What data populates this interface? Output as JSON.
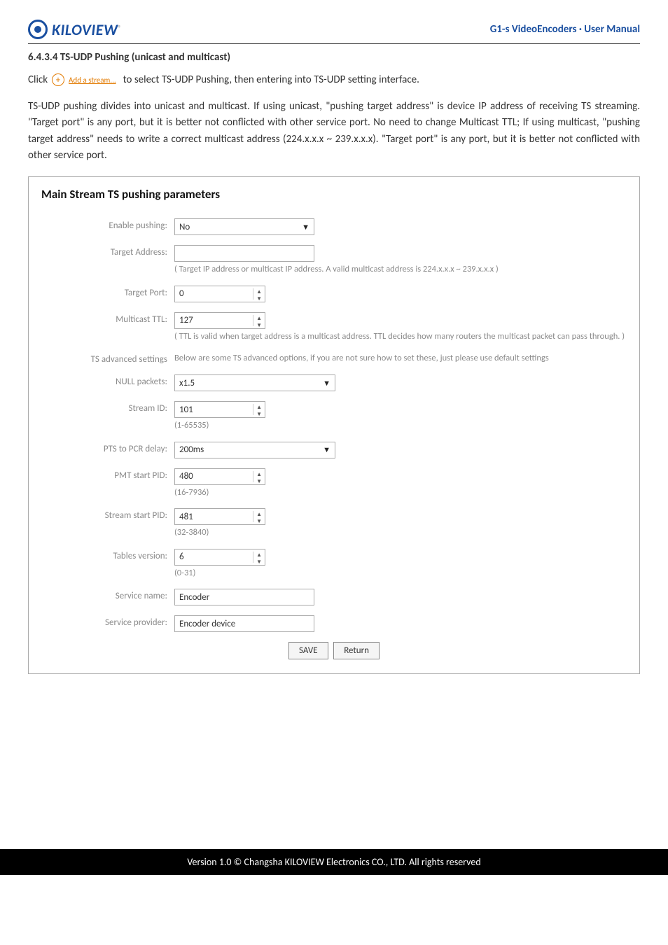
{
  "header": {
    "logo_text": "KILOVIEW",
    "doc_title": "G1-s VideoEncoders · User Manual"
  },
  "section": {
    "heading": "6.4.3.4  TS-UDP Pushing (unicast and multicast)",
    "click_prefix": "Click",
    "add_stream_label": "Add a stream...",
    "click_suffix": "to select TS-UDP Pushing, then entering into TS-UDP setting interface.",
    "paragraph": "TS-UDP pushing divides into unicast and multicast. If using unicast, \"pushing target address\" is device IP address of receiving TS streaming. \"Target port\" is any port, but it is better not conflicted with other service port. No need to change Multicast TTL; If using multicast, \"pushing target address\" needs to write a correct multicast address (224.x.x.x ~ 239.x.x.x). \"Target port\" is any port, but it is better not conflicted with other service port."
  },
  "panel": {
    "title": "Main Stream TS pushing parameters",
    "labels": {
      "enable_pushing": "Enable pushing:",
      "target_address": "Target Address:",
      "target_port": "Target Port:",
      "multicast_ttl": "Multicast TTL:",
      "ts_advanced": "TS advanced settings",
      "null_packets": "NULL packets:",
      "stream_id": "Stream ID:",
      "pts_to_pcr": "PTS to PCR delay:",
      "pmt_start_pid": "PMT start PID:",
      "stream_start_pid": "Stream start PID:",
      "tables_version": "Tables version:",
      "service_name": "Service name:",
      "service_provider": "Service provider:"
    },
    "values": {
      "enable_pushing": "No",
      "target_address": "",
      "target_port": "0",
      "multicast_ttl": "127",
      "null_packets": "x1.5",
      "stream_id": "101",
      "pts_to_pcr": "200ms",
      "pmt_start_pid": "480",
      "stream_start_pid": "481",
      "tables_version": "6",
      "service_name": "Encoder",
      "service_provider": "Encoder device"
    },
    "hints": {
      "target_address": "( Target IP address or multicast IP address. A valid multicast address is 224.x.x.x ~ 239.x.x.x )",
      "multicast_ttl": "( TTL is valid when target address is a multicast address. TTL decides how many routers the multicast packet can pass through. )",
      "ts_advanced": "Below are some TS advanced options, if you are not sure how to set these, just please use default settings",
      "stream_id_range": "(1-65535)",
      "pmt_range": "(16-7936)",
      "stream_start_range": "(32-3840)",
      "tables_range": "(0-31)"
    },
    "buttons": {
      "save": "SAVE",
      "return": "Return"
    }
  },
  "footer": "Version 1.0 © Changsha KILOVIEW Electronics CO., LTD. All rights reserved"
}
